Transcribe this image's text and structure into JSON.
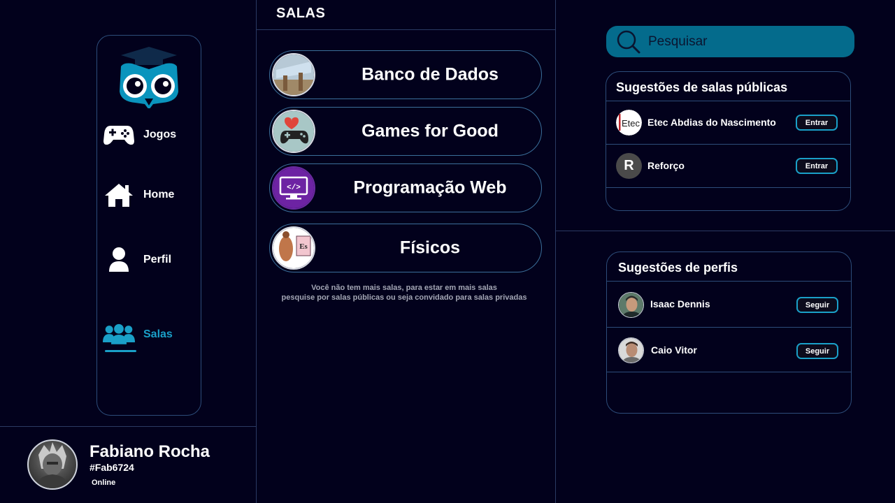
{
  "sidebar": {
    "items": [
      {
        "label": "Jogos",
        "icon": "gamepad-icon"
      },
      {
        "label": "Home",
        "icon": "home-icon"
      },
      {
        "label": "Perfil",
        "icon": "user-icon"
      },
      {
        "label": "Salas",
        "icon": "group-icon",
        "active": true
      }
    ]
  },
  "profile": {
    "name": "Fabiano Rocha",
    "tag": "#Fab6724",
    "status": "Online"
  },
  "main": {
    "title": "SALAS",
    "rooms": [
      {
        "name": "Banco de Dados",
        "icon": "database-thumb"
      },
      {
        "name": "Games for Good",
        "icon": "heart-gamepad-thumb"
      },
      {
        "name": "Programação Web",
        "icon": "code-monitor-thumb"
      },
      {
        "name": "Físicos",
        "icon": "physics-thumb"
      }
    ],
    "empty_line1": "Você não tem mais salas, para estar em mais salas",
    "empty_line2": "pesquise por salas públicas ou seja convidado para salas privadas"
  },
  "search": {
    "placeholder": "Pesquisar"
  },
  "public_rooms": {
    "title": "Sugestões de salas públicas",
    "items": [
      {
        "name": "Etec Abdias do Nascimento",
        "action": "Entrar",
        "avatar_text": "Etec"
      },
      {
        "name": "Reforço",
        "action": "Entrar",
        "avatar_text": "R"
      }
    ]
  },
  "profiles": {
    "title": "Sugestões de perfis",
    "items": [
      {
        "name": "Isaac Dennis",
        "action": "Seguir"
      },
      {
        "name": "Caio Vitor",
        "action": "Seguir"
      }
    ]
  },
  "colors": {
    "background": "#02011c",
    "accent": "#1aa0c8",
    "search_bg": "#046b8c",
    "border": "#2d4d7a"
  }
}
